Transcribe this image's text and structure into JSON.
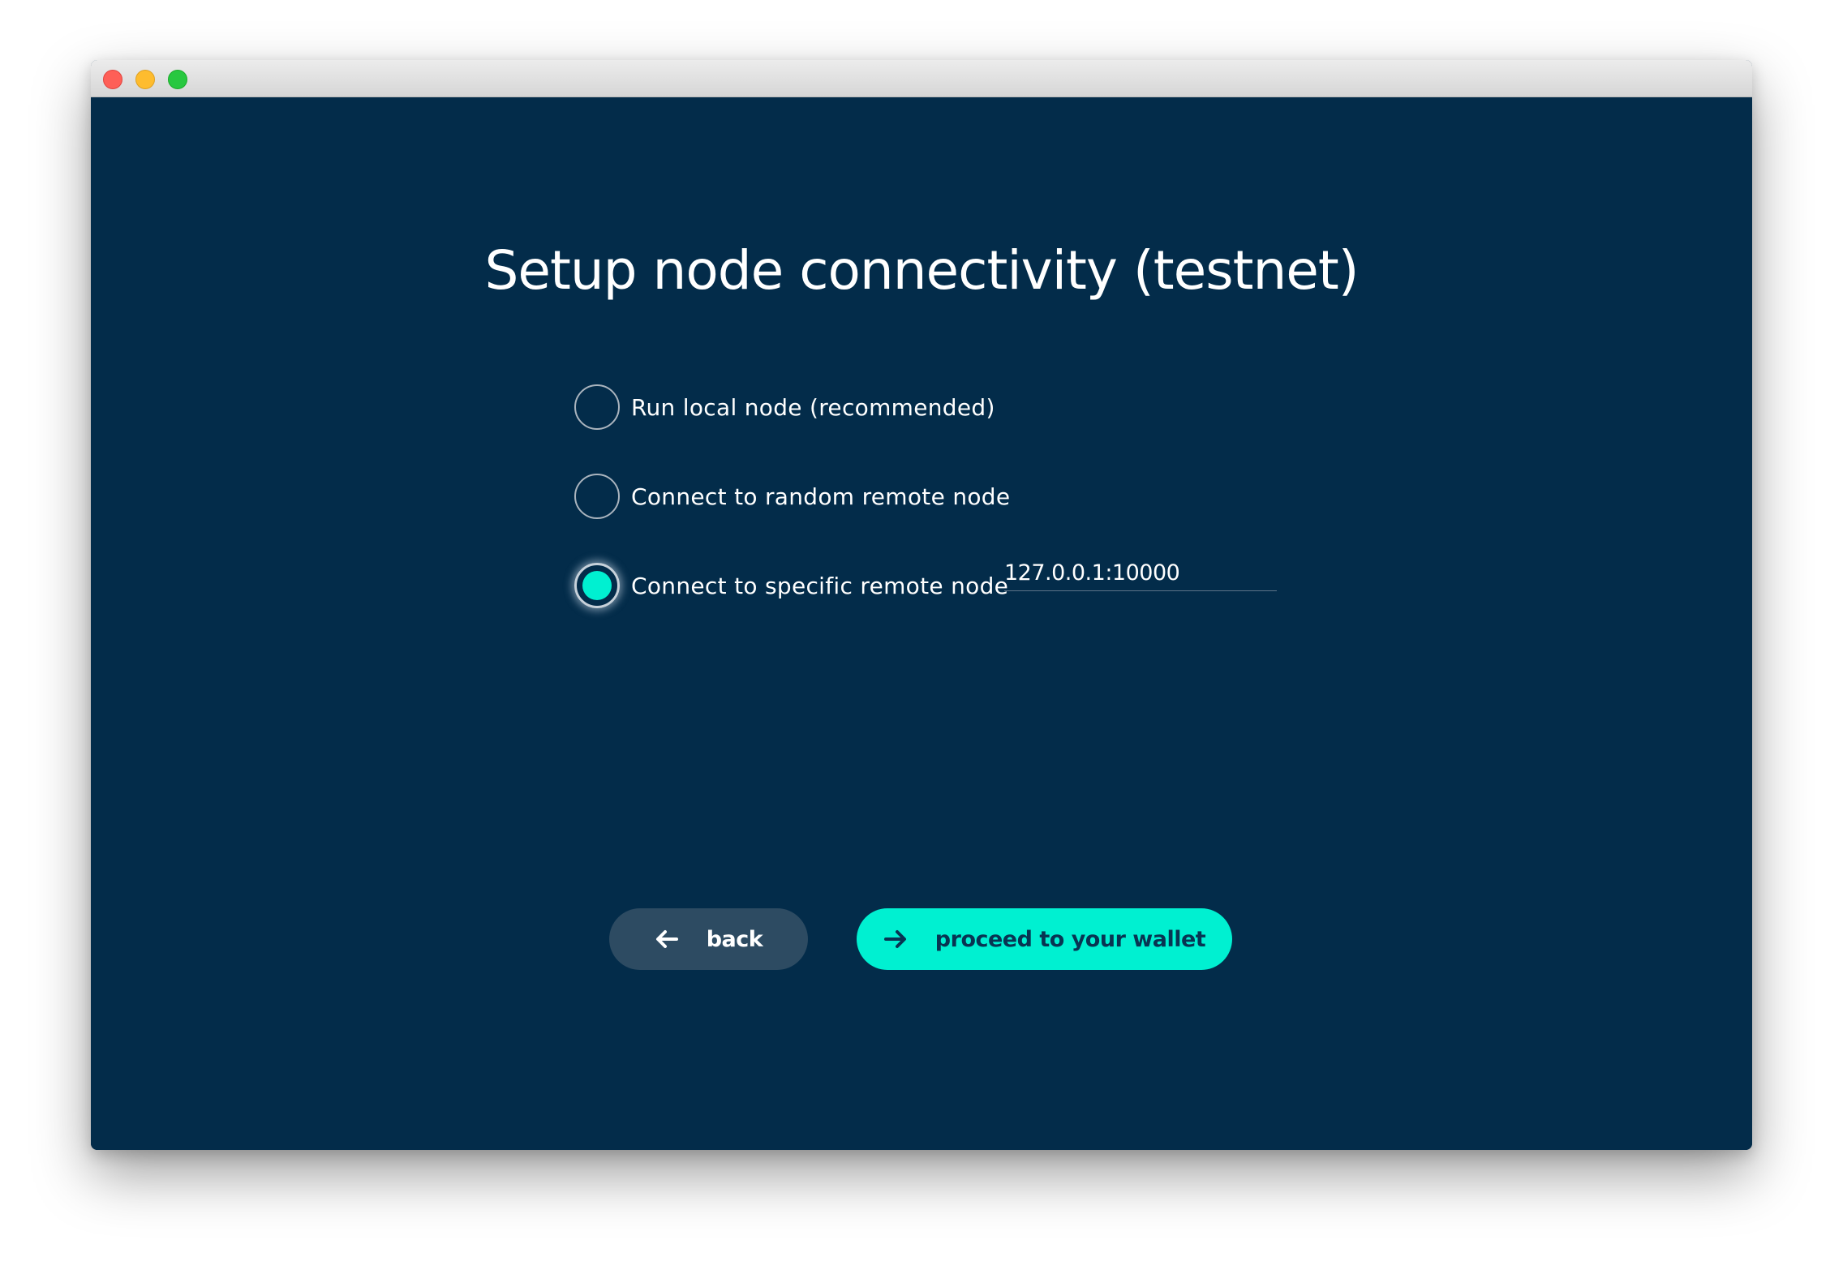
{
  "window": {
    "controls": [
      "close",
      "minimize",
      "maximize"
    ]
  },
  "page": {
    "title": "Setup node connectivity (testnet)"
  },
  "options": [
    {
      "label": "Run local node (recommended)",
      "selected": false
    },
    {
      "label": "Connect to random remote node",
      "selected": false
    },
    {
      "label": "Connect to specific remote node",
      "selected": true
    }
  ],
  "node_address": {
    "value": "127.0.0.1:10000"
  },
  "buttons": {
    "back_label": "back",
    "back_icon": "arrow-left-icon",
    "proceed_label": "proceed to your wallet",
    "proceed_icon": "arrow-right-icon"
  },
  "colors": {
    "background": "#032c4a",
    "accent": "#00f0d1",
    "secondary_button": "#2d4b62",
    "text": "#ffffff"
  }
}
